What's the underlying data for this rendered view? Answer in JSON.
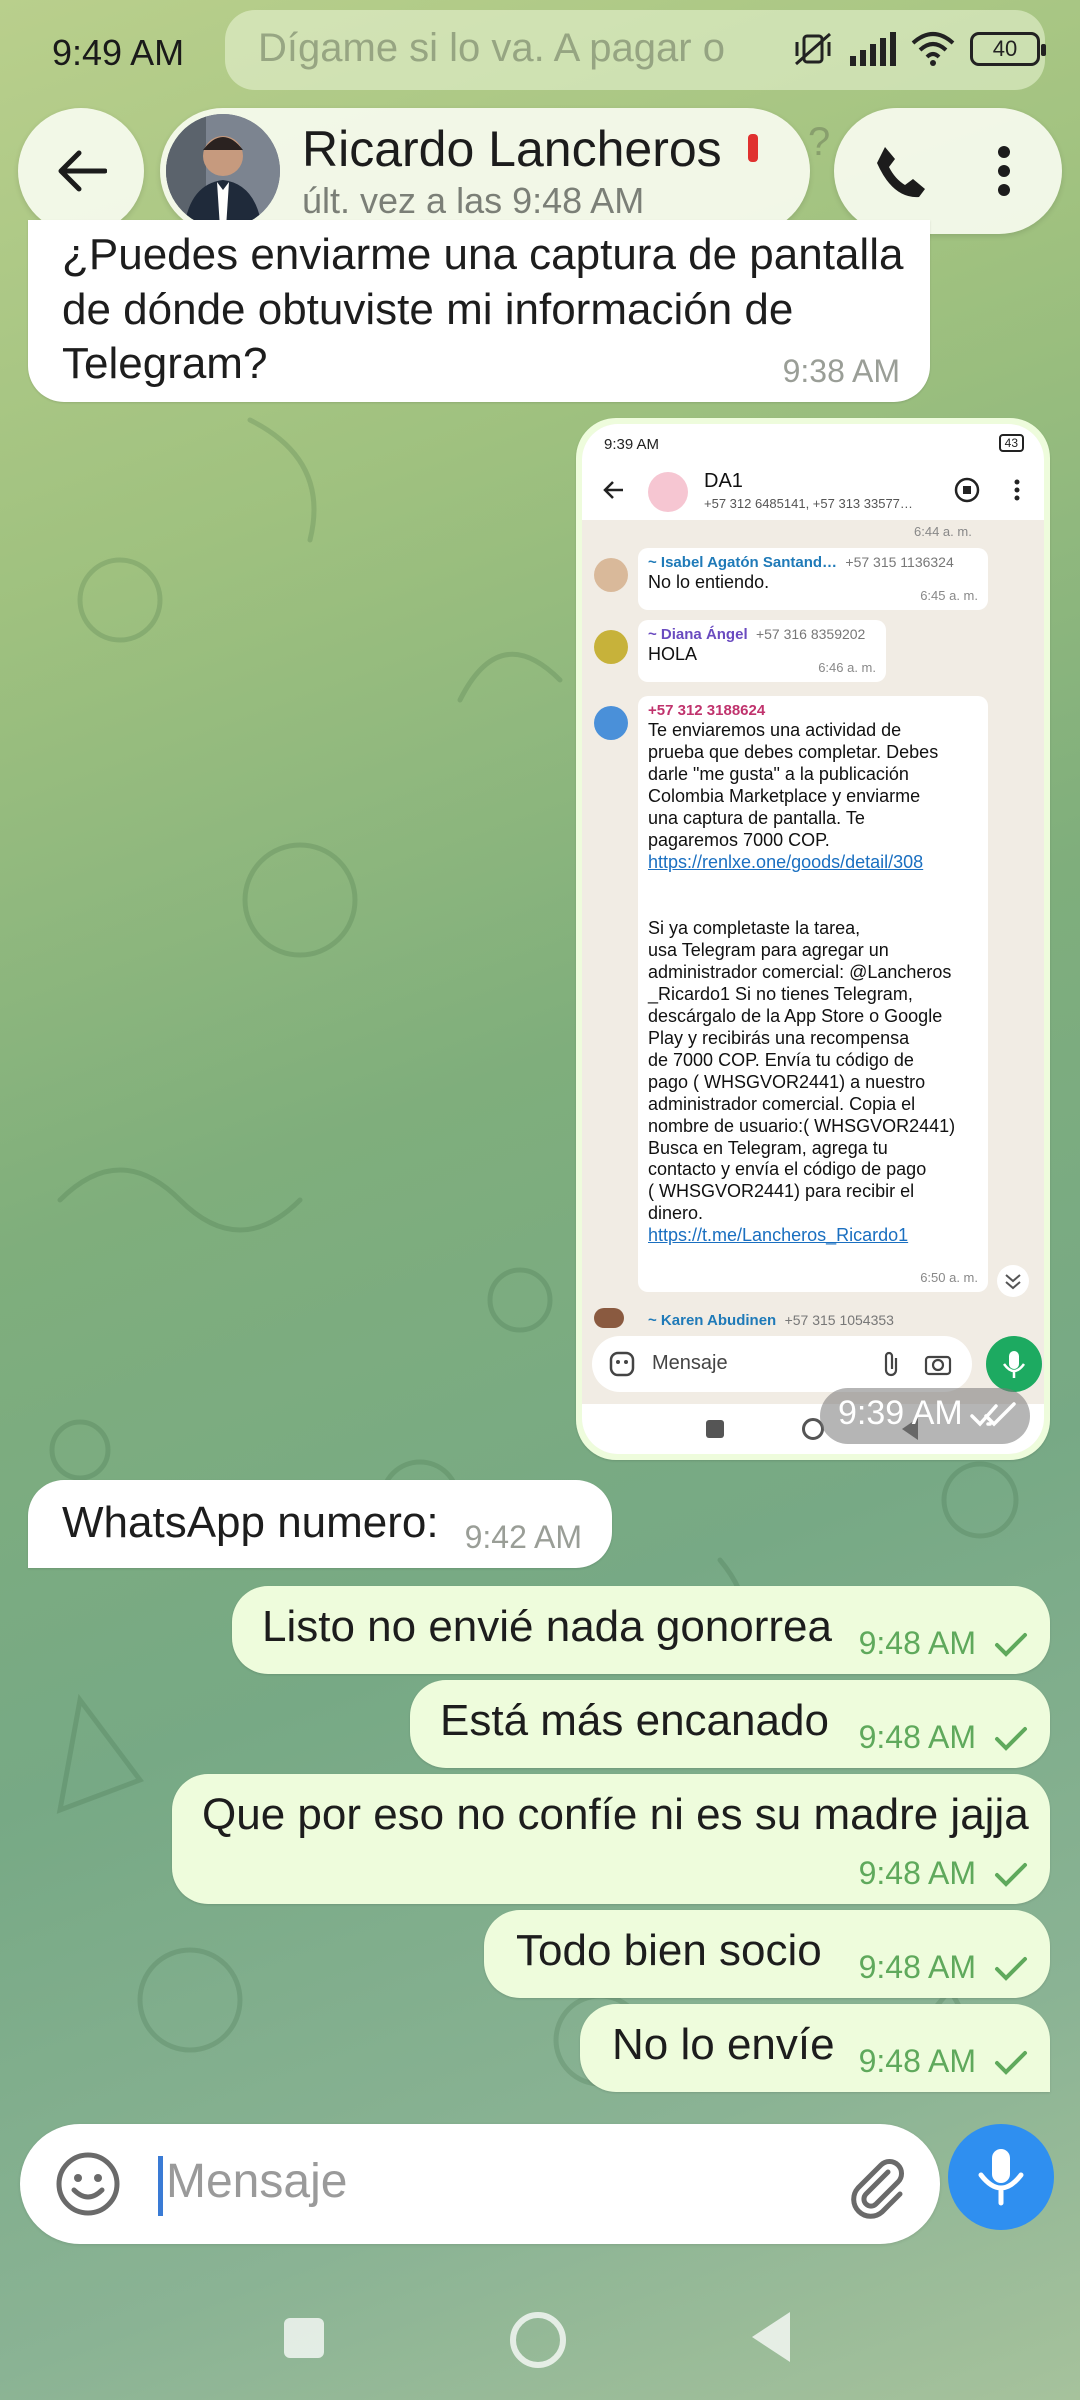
{
  "status_bar": {
    "time": "9:49 AM",
    "battery": "40",
    "notification_preview": "Dígame si lo va. A pagar o",
    "icons": [
      "mute-vibrate-icon",
      "signal-icon",
      "wifi-icon",
      "battery-icon"
    ]
  },
  "header": {
    "contact_name": "Ricardo Lancheros",
    "last_seen": "últ. vez a las 9:48 AM",
    "icons": [
      "back-arrow-icon",
      "phone-icon",
      "kebab-menu-icon"
    ]
  },
  "messages": [
    {
      "direction": "in",
      "text": "¿Puedes enviarme una captura de pantalla de dónde obtuviste mi información de Telegram?",
      "time": "9:38 AM"
    },
    {
      "direction": "out",
      "type": "image",
      "time": "9:39 AM",
      "status": "read"
    },
    {
      "direction": "in",
      "text": "WhatsApp numero:",
      "time": "9:42 AM"
    },
    {
      "direction": "out",
      "text": "Listo no envié nada gonorrea",
      "time": "9:48 AM",
      "status": "sent"
    },
    {
      "direction": "out",
      "text": "Está más encanado",
      "time": "9:48 AM",
      "status": "sent"
    },
    {
      "direction": "out",
      "text": "Que por eso no confíe ni es su madre jajja",
      "time": "9:48 AM",
      "status": "sent"
    },
    {
      "direction": "out",
      "text": "Todo bien socio",
      "time": "9:48 AM",
      "status": "sent"
    },
    {
      "direction": "out",
      "text": "No lo envíe",
      "time": "9:48 AM",
      "status": "sent"
    }
  ],
  "screenshot": {
    "status_time": "9:39 AM",
    "battery": "43",
    "group_name": "DA1",
    "group_members": "+57 312 6485141, +57 313 33577…",
    "top_time": "6:44 a. m.",
    "msgs": [
      {
        "sender": "~ Isabel Agatón Santand…",
        "phone": "+57 315 1136324",
        "text": "No lo entiendo.",
        "time": "6:45 a. m.",
        "color": "#1f7ab8"
      },
      {
        "sender": "~ Diana Ángel",
        "phone": "+57 316 8359202",
        "text": "HOLA",
        "time": "6:46 a. m.",
        "color": "#6a4bc0"
      },
      {
        "sender": "+57 312 3188624",
        "phone": "",
        "color": "#c0336d",
        "time": "6:50 a. m.",
        "text_lines": [
          "Te enviaremos una actividad de",
          "prueba que debes completar. Debes",
          "darle \"me gusta\" a la publicación",
          "Colombia Marketplace  y enviarme",
          "una captura de pantalla. Te",
          "pagaremos 7000 COP."
        ],
        "link1": "https://renlxe.one/goods/detail/308",
        "text_lines2": [
          "Si ya completaste la tarea,",
          "usa Telegram para agregar un",
          "administrador comercial:  @Lancheros",
          "_Ricardo1 Si no tienes Telegram,",
          "descárgalo de la App Store o Google",
          "Play y recibirás una recompensa",
          "de 7000 COP. Envía tu código de",
          "pago ( WHSGVOR2441) a nuestro",
          "administrador comercial. Copia el",
          "nombre de usuario:( WHSGVOR2441)",
          "Busca en Telegram, agrega tu",
          "contacto y envía el código de pago",
          "( WHSGVOR2441) para recibir el",
          "dinero."
        ],
        "link2": "https://t.me/Lancheros_Ricardo1"
      },
      {
        "sender": "~ Karen Abudinen",
        "phone": "+57 315 1054353",
        "color": "#1f7ab8"
      }
    ],
    "input_placeholder": "Mensaje"
  },
  "input": {
    "placeholder": "Mensaje"
  },
  "colors": {
    "outgoing": "#eefcdc",
    "incoming": "#ffffff",
    "accent": "#2f8ff0",
    "tick": "#5fa95c"
  }
}
